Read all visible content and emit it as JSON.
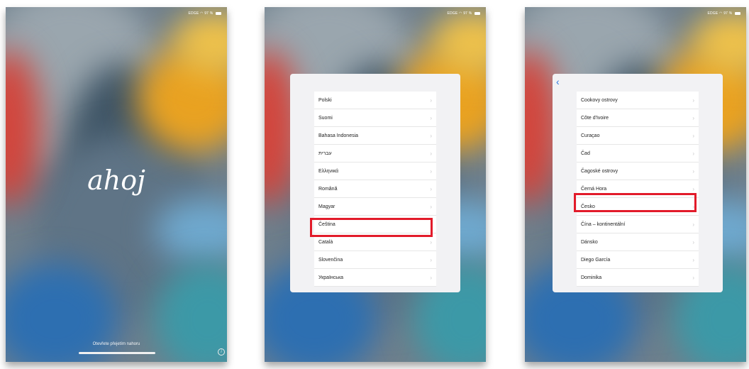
{
  "status_bar": {
    "carrier": "EDGE",
    "battery": "97 %"
  },
  "panel1": {
    "greeting": "ahoj",
    "swipe_hint": "Otevřete přejetím nahoru"
  },
  "panel2": {
    "languages": [
      "Polski",
      "Suomi",
      "Bahasa Indonesia",
      "עברית",
      "Ελληνικά",
      "Română",
      "Magyar",
      "Čeština",
      "Català",
      "Slovenčina",
      "Українська"
    ],
    "selected": "Čeština"
  },
  "panel3": {
    "regions": [
      "Cookovy ostrovy",
      "Côte d'Ivoire",
      "Curaçao",
      "Čad",
      "Čagoské ostrovy",
      "Černá Hora",
      "Česko",
      "Čína – kontinentální",
      "Dánsko",
      "Diego García",
      "Dominika"
    ],
    "selected": "Česko"
  },
  "colors": {
    "highlight": "#e21b2a",
    "back_accent": "#2b77e0"
  }
}
